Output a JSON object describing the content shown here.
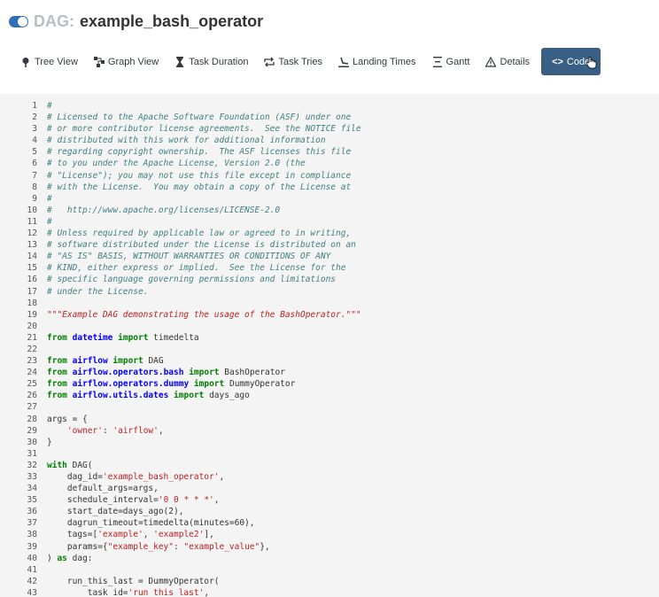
{
  "header": {
    "dag_prefix": "DAG:",
    "dag_name": "example_bash_operator"
  },
  "nav": {
    "tabs": [
      {
        "label": "Tree View",
        "icon": "tree-icon"
      },
      {
        "label": "Graph View",
        "icon": "graph-icon"
      },
      {
        "label": "Task Duration",
        "icon": "hourglass-icon"
      },
      {
        "label": "Task Tries",
        "icon": "retry-icon"
      },
      {
        "label": "Landing Times",
        "icon": "landing-icon"
      },
      {
        "label": "Gantt",
        "icon": "gantt-icon"
      },
      {
        "label": "Details",
        "icon": "warning-icon"
      },
      {
        "label": "Code",
        "icon": "code-icon",
        "active": true
      }
    ]
  },
  "code": {
    "lines": [
      [
        [
          "c",
          "#"
        ]
      ],
      [
        [
          "c",
          "# Licensed to the Apache Software Foundation (ASF) under one"
        ]
      ],
      [
        [
          "c",
          "# or more contributor license agreements.  See the NOTICE file"
        ]
      ],
      [
        [
          "c",
          "# distributed with this work for additional information"
        ]
      ],
      [
        [
          "c",
          "# regarding copyright ownership.  The ASF licenses this file"
        ]
      ],
      [
        [
          "c",
          "# to you under the Apache License, Version 2.0 (the"
        ]
      ],
      [
        [
          "c",
          "# \"License\"); you may not use this file except in compliance"
        ]
      ],
      [
        [
          "c",
          "# with the License.  You may obtain a copy of the License at"
        ]
      ],
      [
        [
          "c",
          "#"
        ]
      ],
      [
        [
          "c",
          "#   http://www.apache.org/licenses/LICENSE-2.0"
        ]
      ],
      [
        [
          "c",
          "#"
        ]
      ],
      [
        [
          "c",
          "# Unless required by applicable law or agreed to in writing,"
        ]
      ],
      [
        [
          "c",
          "# software distributed under the License is distributed on an"
        ]
      ],
      [
        [
          "c",
          "# \"AS IS\" BASIS, WITHOUT WARRANTIES OR CONDITIONS OF ANY"
        ]
      ],
      [
        [
          "c",
          "# KIND, either express or implied.  See the License for the"
        ]
      ],
      [
        [
          "c",
          "# specific language governing permissions and limitations"
        ]
      ],
      [
        [
          "c",
          "# under the License."
        ]
      ],
      [],
      [
        [
          "d",
          "\"\"\"Example DAG demonstrating the usage of the BashOperator.\"\"\""
        ]
      ],
      [],
      [
        [
          "k",
          "from"
        ],
        [
          "t",
          " "
        ],
        [
          "m",
          "datetime"
        ],
        [
          "t",
          " "
        ],
        [
          "k",
          "import"
        ],
        [
          "t",
          " timedelta"
        ]
      ],
      [],
      [
        [
          "k",
          "from"
        ],
        [
          "t",
          " "
        ],
        [
          "m",
          "airflow"
        ],
        [
          "t",
          " "
        ],
        [
          "k",
          "import"
        ],
        [
          "t",
          " DAG"
        ]
      ],
      [
        [
          "k",
          "from"
        ],
        [
          "t",
          " "
        ],
        [
          "m",
          "airflow.operators.bash"
        ],
        [
          "t",
          " "
        ],
        [
          "k",
          "import"
        ],
        [
          "t",
          " BashOperator"
        ]
      ],
      [
        [
          "k",
          "from"
        ],
        [
          "t",
          " "
        ],
        [
          "m",
          "airflow.operators.dummy"
        ],
        [
          "t",
          " "
        ],
        [
          "k",
          "import"
        ],
        [
          "t",
          " DummyOperator"
        ]
      ],
      [
        [
          "k",
          "from"
        ],
        [
          "t",
          " "
        ],
        [
          "m",
          "airflow.utils.dates"
        ],
        [
          "t",
          " "
        ],
        [
          "k",
          "import"
        ],
        [
          "t",
          " days_ago"
        ]
      ],
      [],
      [
        [
          "t",
          "args = {"
        ]
      ],
      [
        [
          "t",
          "    "
        ],
        [
          "s",
          "'owner'"
        ],
        [
          "t",
          ": "
        ],
        [
          "s",
          "'airflow'"
        ],
        [
          "t",
          ","
        ]
      ],
      [
        [
          "t",
          "}"
        ]
      ],
      [],
      [
        [
          "k",
          "with"
        ],
        [
          "t",
          " DAG("
        ]
      ],
      [
        [
          "t",
          "    dag_id="
        ],
        [
          "s",
          "'example_bash_operator'"
        ],
        [
          "t",
          ","
        ]
      ],
      [
        [
          "t",
          "    default_args=args,"
        ]
      ],
      [
        [
          "t",
          "    schedule_interval="
        ],
        [
          "s",
          "'0 0 * * *'"
        ],
        [
          "t",
          ","
        ]
      ],
      [
        [
          "t",
          "    start_date=days_ago(2),"
        ]
      ],
      [
        [
          "t",
          "    dagrun_timeout=timedelta(minutes=60),"
        ]
      ],
      [
        [
          "t",
          "    tags=["
        ],
        [
          "s",
          "'example'"
        ],
        [
          "t",
          ", "
        ],
        [
          "s",
          "'example2'"
        ],
        [
          "t",
          "],"
        ]
      ],
      [
        [
          "t",
          "    params={"
        ],
        [
          "s",
          "\"example_key\""
        ],
        [
          "t",
          ": "
        ],
        [
          "s",
          "\"example_value\""
        ],
        [
          "t",
          "},"
        ]
      ],
      [
        [
          "t",
          ") "
        ],
        [
          "k",
          "as"
        ],
        [
          "t",
          " dag:"
        ]
      ],
      [],
      [
        [
          "t",
          "    run_this_last = DummyOperator("
        ]
      ],
      [
        [
          "t",
          "        task_id="
        ],
        [
          "s",
          "'run_this_last'"
        ],
        [
          "t",
          ","
        ]
      ]
    ]
  }
}
